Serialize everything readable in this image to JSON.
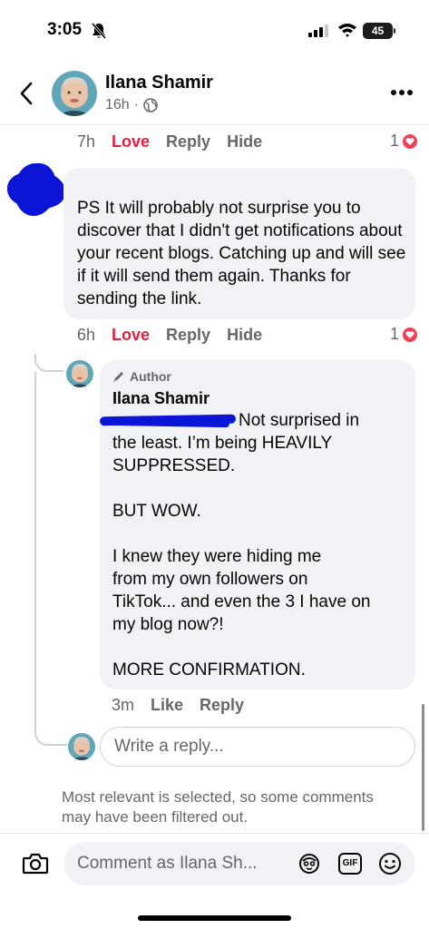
{
  "status_bar": {
    "time": "3:05",
    "battery": "45"
  },
  "header": {
    "name": "Ilana Shamir",
    "time": "16h",
    "dot": "·"
  },
  "top_comment_actions": {
    "time": "7h",
    "love": "Love",
    "reply": "Reply",
    "hide": "Hide",
    "reaction_count": "1"
  },
  "comment": {
    "text": "PS It will probably not surprise you to discover that I didn't get notifications about your recent blogs. Catching up and will see if it will send them again. Thanks for sending the link.",
    "actions": {
      "time": "6h",
      "love": "Love",
      "reply": "Reply",
      "hide": "Hide",
      "reaction_count": "1"
    }
  },
  "reply": {
    "badge": "Author",
    "name": "Ilana Shamir",
    "text_first_line": "Not surprised in",
    "text_rest": "the least. I’m being HEAVILY\nSUPPRESSED.\n\nBUT WOW.\n\nI knew they were hiding me\nfrom my own followers on\nTikTok... and even the 3 I have on\nmy blog now?!\n\nMORE CONFIRMATION.",
    "actions": {
      "time": "3m",
      "like": "Like",
      "reply": "Reply"
    }
  },
  "reply_input": {
    "placeholder": "Write a reply..."
  },
  "filter_note": "Most relevant is selected, so some comments may have been filtered out.",
  "composer": {
    "placeholder": "Comment as Ilana Sh...",
    "gif": "GIF"
  },
  "colors": {
    "love": "#e41e3f",
    "redaction": "#0a15d6",
    "bubble": "#f0f2f5"
  }
}
